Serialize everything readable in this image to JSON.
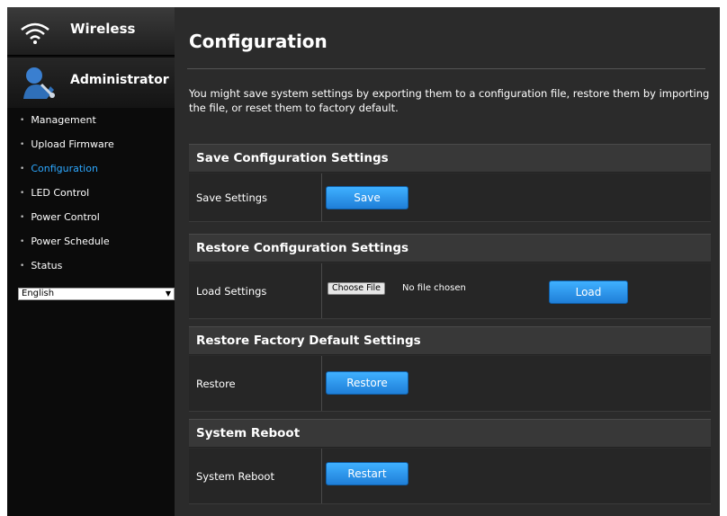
{
  "sidebar": {
    "wireless_label": "Wireless",
    "admin_label": "Administrator",
    "items": [
      {
        "label": "Management"
      },
      {
        "label": "Upload Firmware"
      },
      {
        "label": "Configuration"
      },
      {
        "label": "LED Control"
      },
      {
        "label": "Power Control"
      },
      {
        "label": "Power Schedule"
      },
      {
        "label": "Status"
      }
    ],
    "active_item": "Configuration",
    "language": "English"
  },
  "main": {
    "title": "Configuration",
    "description": "You might save system settings by exporting them to a configuration file, restore them by importing the file, or reset them to factory default.",
    "sections": {
      "save": {
        "header": "Save Configuration Settings",
        "label": "Save Settings",
        "button": "Save"
      },
      "restore_config": {
        "header": "Restore Configuration Settings",
        "label": "Load Settings",
        "file_button": "Choose File",
        "file_status": "No file chosen",
        "button": "Load"
      },
      "factory": {
        "header": "Restore Factory Default Settings",
        "label": "Restore",
        "button": "Restore"
      },
      "reboot": {
        "header": "System Reboot",
        "label": "System Reboot",
        "button": "Restart"
      }
    }
  },
  "colors": {
    "accent": "#2da8ff",
    "button": "#2a8fe6",
    "background": "#2b2b2b"
  }
}
